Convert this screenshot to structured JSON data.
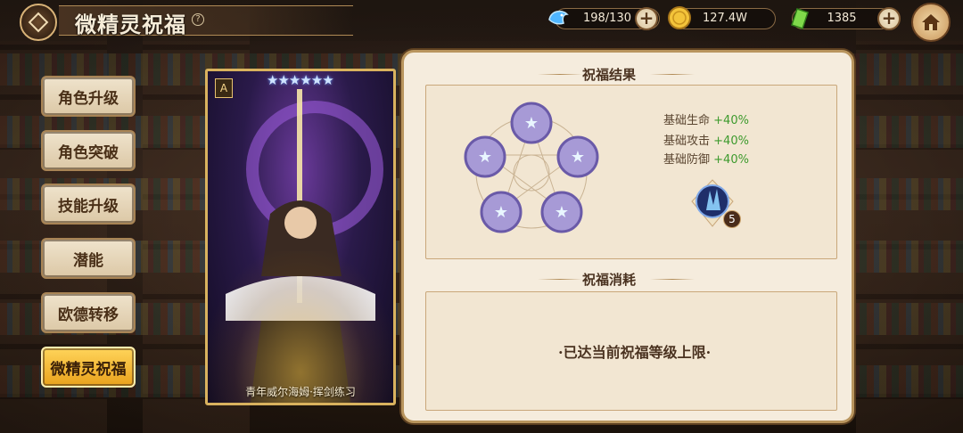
{
  "header": {
    "title": "微精灵祝福",
    "help_symbol": "?"
  },
  "resources": {
    "stamina": {
      "value": "198/130",
      "icon": "blue-fish-icon"
    },
    "gold": {
      "value": "127.4W",
      "icon": "gold-coin-icon"
    },
    "gem": {
      "value": "1385",
      "icon": "green-crystal-icon"
    }
  },
  "sidebar": {
    "items": [
      {
        "label": "角色升级",
        "active": false
      },
      {
        "label": "角色突破",
        "active": false
      },
      {
        "label": "技能升级",
        "active": false
      },
      {
        "label": "潜能",
        "active": false
      },
      {
        "label": "欧德转移",
        "active": false
      },
      {
        "label": "微精灵祝福",
        "active": true
      }
    ]
  },
  "card": {
    "name": "青年威尔海姆·挥剑练习",
    "stars": "★★★★★★",
    "rank_letter": "A"
  },
  "blessing_result": {
    "title": "祝福结果",
    "stats": [
      {
        "label": "基础生命",
        "value": "+40%"
      },
      {
        "label": "基础攻击",
        "value": "+40%"
      },
      {
        "label": "基础防御",
        "value": "+40%"
      }
    ],
    "item_count": "5"
  },
  "blessing_cost": {
    "title": "祝福消耗",
    "message": "·已达当前祝福等级上限·"
  },
  "colors": {
    "accent_gold": "#e9a21c",
    "panel_bg": "#f5ecdd",
    "stat_green": "#3d9a2d"
  }
}
